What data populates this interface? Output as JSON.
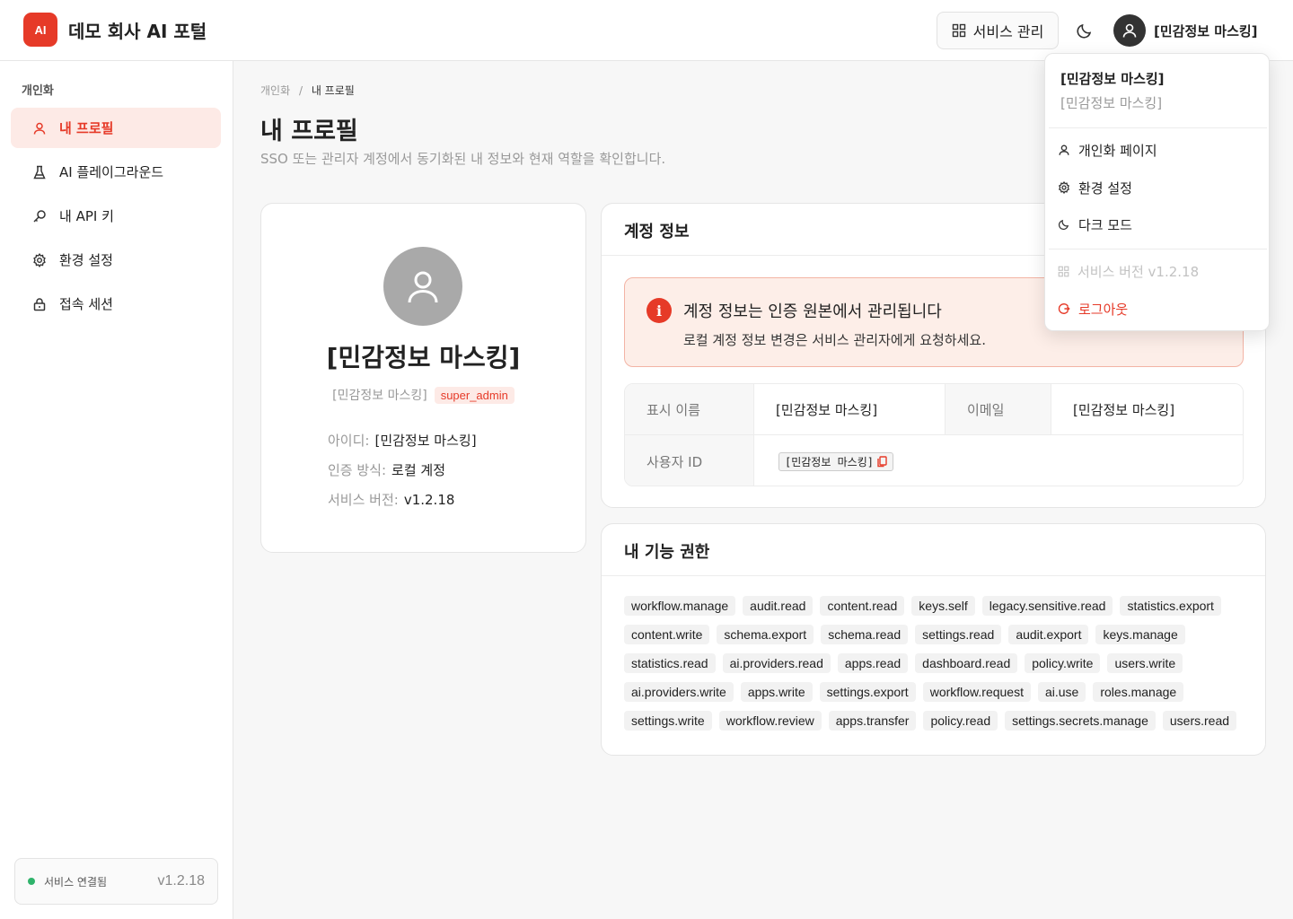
{
  "header": {
    "logo_text": "AI",
    "app_title": "데모 회사 AI 포털",
    "service_manage_label": "서비스 관리",
    "user_name": "[민감정보 마스킹]"
  },
  "sidebar": {
    "section_title": "개인화",
    "items": [
      {
        "label": "내 프로필",
        "icon": "user-icon",
        "active": true
      },
      {
        "label": "AI 플레이그라운드",
        "icon": "flask-icon"
      },
      {
        "label": "내 API 키",
        "icon": "key-icon"
      },
      {
        "label": "환경 설정",
        "icon": "gear-icon"
      },
      {
        "label": "접속 세션",
        "icon": "lock-icon"
      }
    ],
    "status_text": "서비스 연결됨",
    "status_version": "v1.2.18"
  },
  "breadcrumb": {
    "parent": "개인화",
    "separator": "/",
    "current": "내 프로필"
  },
  "page": {
    "title": "내 프로필",
    "description": "SSO 또는 관리자 계정에서 동기화된 내 정보와 현재 역할을 확인합니다."
  },
  "profile": {
    "name": "[민감정보 마스킹]",
    "sub": "[민감정보 마스킹]",
    "role": "super_admin",
    "id_label": "아이디:",
    "id_value": "[민감정보 마스킹]",
    "auth_label": "인증 방식:",
    "auth_value": "로컬 계정",
    "version_label": "서비스 버전:",
    "version_value": "v1.2.18"
  },
  "account": {
    "title": "계정 정보",
    "alert_title": "계정 정보는 인증 원본에서 관리됩니다",
    "alert_message": "로컬 계정 정보 변경은 서비스 관리자에게 요청하세요.",
    "display_name_label": "표시 이름",
    "display_name_value": "[민감정보 마스킹]",
    "email_label": "이메일",
    "email_value": "[민감정보 마스킹]",
    "user_id_label": "사용자 ID",
    "user_id_value": "[민감정보 마스킹]"
  },
  "permissions": {
    "title": "내 기능 권한",
    "items": [
      "workflow.manage",
      "audit.read",
      "content.read",
      "keys.self",
      "legacy.sensitive.read",
      "statistics.export",
      "content.write",
      "schema.export",
      "schema.read",
      "settings.read",
      "audit.export",
      "keys.manage",
      "statistics.read",
      "ai.providers.read",
      "apps.read",
      "dashboard.read",
      "policy.write",
      "users.write",
      "ai.providers.write",
      "apps.write",
      "settings.export",
      "workflow.request",
      "ai.use",
      "roles.manage",
      "settings.write",
      "workflow.review",
      "apps.transfer",
      "policy.read",
      "settings.secrets.manage",
      "users.read"
    ]
  },
  "dropdown": {
    "name": "[민감정보 마스킹]",
    "sub": "[민감정보 마스킹]",
    "personal_page": "개인화 페이지",
    "settings": "환경 설정",
    "dark_mode": "다크 모드",
    "version": "서비스 버전 v1.2.18",
    "logout": "로그아웃"
  },
  "colors": {
    "accent": "#e63a28",
    "accent_soft": "#fdeae6",
    "status_ok": "#2fb36b"
  }
}
